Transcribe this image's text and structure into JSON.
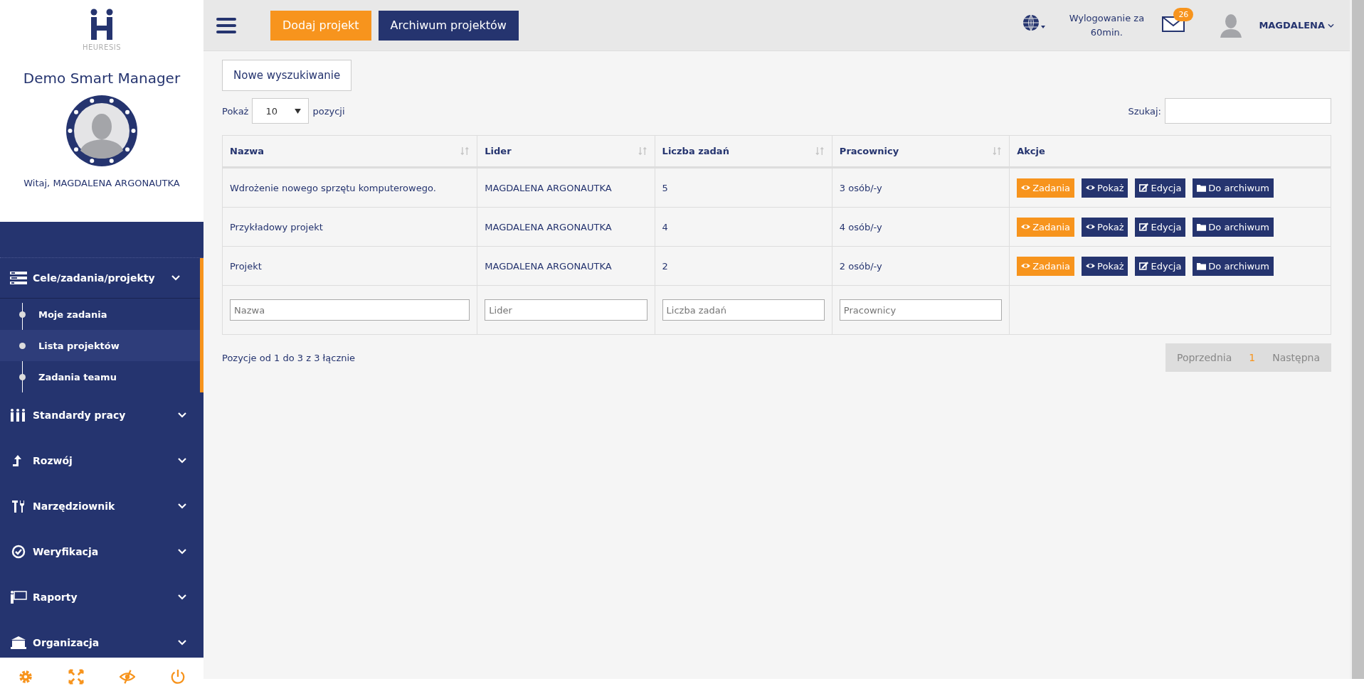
{
  "sidebar": {
    "logo_text": "HEURESIS",
    "app_title": "Demo Smart Manager",
    "greeting": "Witaj, MAGDALENA ARGONAUTKA",
    "menu": [
      {
        "label": "Cele/zadania/projekty",
        "kind": "list",
        "expanded": true,
        "children": [
          {
            "label": "Moje zadania",
            "selected": false
          },
          {
            "label": "Lista projektów",
            "selected": true
          },
          {
            "label": "Zadania teamu",
            "selected": false
          }
        ]
      },
      {
        "label": "Standardy pracy",
        "kind": "people",
        "expanded": false
      },
      {
        "label": "Rozwój",
        "kind": "arrow",
        "expanded": false
      },
      {
        "label": "Narzędziownik",
        "kind": "tools",
        "expanded": false
      },
      {
        "label": "Weryfikacja",
        "kind": "check",
        "expanded": false
      },
      {
        "label": "Raporty",
        "kind": "board",
        "expanded": false
      },
      {
        "label": "Organizacja",
        "kind": "building",
        "expanded": false
      }
    ],
    "footer_icons": [
      {
        "kind": "settings"
      },
      {
        "kind": "fullscreen"
      },
      {
        "kind": "hide"
      },
      {
        "kind": "power"
      }
    ]
  },
  "topbar": {
    "buttons": [
      {
        "label": "Dodaj projekt",
        "kind": "primary"
      },
      {
        "label": "Archiwum projektów",
        "kind": "dark"
      }
    ],
    "logout": "Wylogowanie za 60min.",
    "messages_badge": "26",
    "user": "MAGDALENA"
  },
  "content": {
    "new_search": "Nowe wyszukiwanie",
    "show_label": "Pokaż",
    "page_size": "10",
    "show_suffix": "pozycji",
    "search_label": "Szukaj:",
    "table": {
      "columns": [
        {
          "label": "Nazwa",
          "sortable": true
        },
        {
          "label": "Lider",
          "sortable": true
        },
        {
          "label": "Liczba zadań",
          "sortable": true
        },
        {
          "label": "Pracownicy",
          "sortable": true
        },
        {
          "label": "Akcje",
          "sortable": false
        }
      ],
      "rows": [
        {
          "name": "Wdrożenie nowego sprzętu komputerowego.",
          "leader": "MAGDALENA ARGONAUTKA",
          "tasks": "5",
          "workers": "3 osób/-y",
          "actions": [
            {
              "label": "Zadania",
              "kind": "tasks"
            },
            {
              "label": "Pokaż",
              "kind": "show"
            },
            {
              "label": "Edycja",
              "kind": "edit"
            },
            {
              "label": "Do archiwum",
              "kind": "archive"
            }
          ]
        },
        {
          "name": "Przykładowy projekt",
          "leader": "MAGDALENA ARGONAUTKA",
          "tasks": "4",
          "workers": "4 osób/-y",
          "actions": [
            {
              "label": "Zadania",
              "kind": "tasks"
            },
            {
              "label": "Pokaż",
              "kind": "show"
            },
            {
              "label": "Edycja",
              "kind": "edit"
            },
            {
              "label": "Do archiwum",
              "kind": "archive"
            }
          ]
        },
        {
          "name": "Projekt",
          "leader": "MAGDALENA ARGONAUTKA",
          "tasks": "2",
          "workers": "2 osób/-y",
          "actions": [
            {
              "label": "Zadania",
              "kind": "tasks"
            },
            {
              "label": "Pokaż",
              "kind": "show"
            },
            {
              "label": "Edycja",
              "kind": "edit"
            },
            {
              "label": "Do archiwum",
              "kind": "archive"
            }
          ]
        }
      ],
      "filters": [
        {
          "placeholder": "Nazwa"
        },
        {
          "placeholder": "Lider"
        },
        {
          "placeholder": "Liczba zadań"
        },
        {
          "placeholder": "Pracownicy"
        }
      ]
    },
    "info": "Pozycje od 1 do 3 z 3 łącznie",
    "pagination": [
      {
        "label": "Poprzednia",
        "selected": false
      },
      {
        "label": "1",
        "selected": true
      },
      {
        "label": "Następna",
        "selected": false
      }
    ]
  }
}
